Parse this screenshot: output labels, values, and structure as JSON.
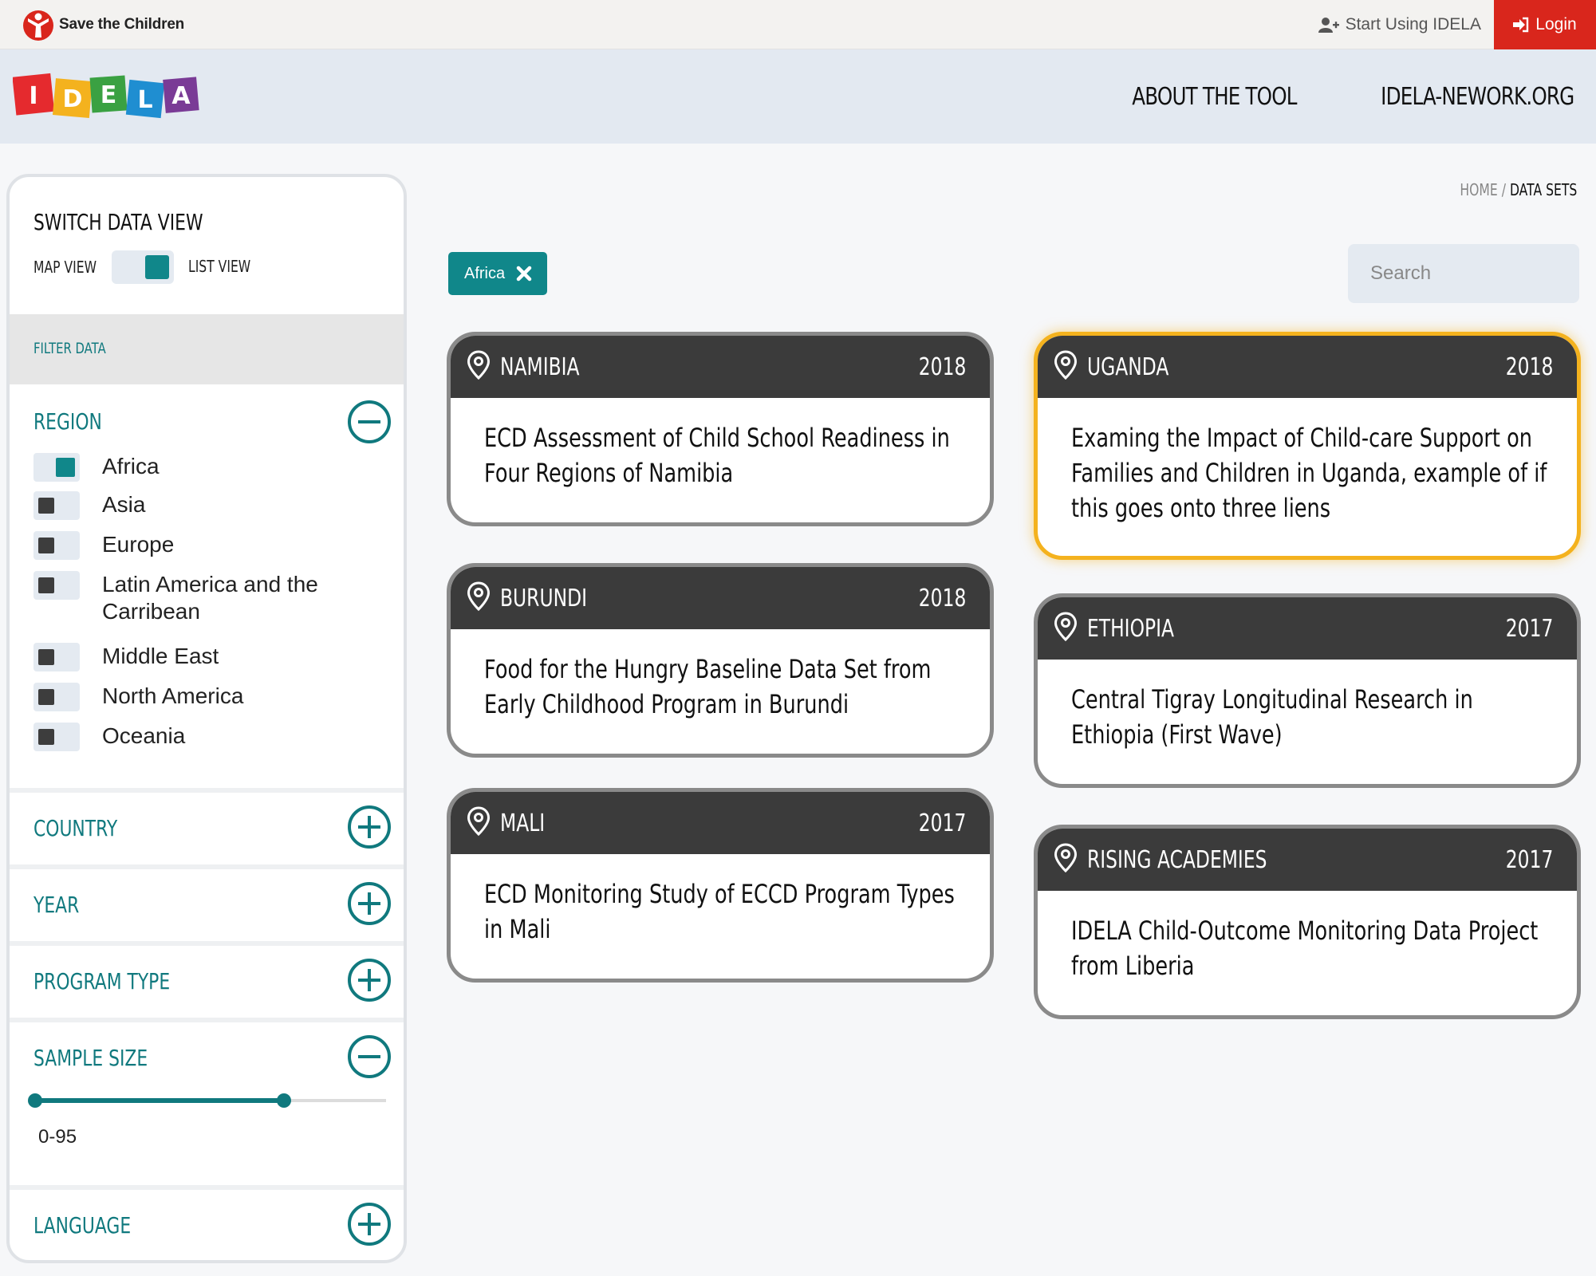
{
  "topbar": {
    "org_name": "Save the Children",
    "start_label": "Start Using IDELA",
    "login_label": "Login"
  },
  "header": {
    "logo_letters": [
      "I",
      "D",
      "E",
      "L",
      "A"
    ],
    "nav": [
      "ABOUT THE TOOL",
      "IDELA-NEWORK.ORG"
    ]
  },
  "sidebar": {
    "switch_title": "SWITCH DATA VIEW",
    "map_view": "MAP VIEW",
    "list_view": "LIST VIEW",
    "filter_label": "FILTER DATA",
    "region": {
      "title": "REGION",
      "items": [
        {
          "label": "Africa",
          "checked": true
        },
        {
          "label": "Asia",
          "checked": false
        },
        {
          "label": "Europe",
          "checked": false
        },
        {
          "label": "Latin America and the Carribean",
          "checked": false
        },
        {
          "label": "Middle East",
          "checked": false
        },
        {
          "label": "North America",
          "checked": false
        },
        {
          "label": "Oceania",
          "checked": false
        }
      ]
    },
    "country_title": "COUNTRY",
    "year_title": "YEAR",
    "program_type_title": "PROGRAM TYPE",
    "sample_size": {
      "title": "SAMPLE SIZE",
      "range_text": "0-95",
      "low_fraction": 0.0,
      "high_fraction": 0.71
    },
    "language_title": "LANGUAGE"
  },
  "breadcrumb": {
    "home": "HOME",
    "separator": "/",
    "current": "DATA SETS"
  },
  "active_filter": "Africa",
  "search": {
    "placeholder": "Search"
  },
  "cards": [
    {
      "country": "NAMIBIA",
      "year": "2018",
      "title": "ECD Assessment of Child School Readiness in Four Regions of Namibia"
    },
    {
      "country": "BURUNDI",
      "year": "2018",
      "title": "Food for the Hungry Baseline Data Set from Early Childhood Program in Burundi"
    },
    {
      "country": "MALI",
      "year": "2017",
      "title": "ECD Monitoring Study of ECCD Program Types in Mali"
    },
    {
      "country": "UGANDA",
      "year": "2018",
      "title": "Examing the Impact of Child-care Support on Families and Children in Uganda, example of if this goes onto three liens"
    },
    {
      "country": "ETHIOPIA",
      "year": "2017",
      "title": "Central Tigray Longitudinal Research in Ethiopia (First Wave)"
    },
    {
      "country": "RISING ACADEMIES",
      "year": "2017",
      "title": "IDELA Child-Outcome Monitoring Data Project from Liberia"
    }
  ],
  "colors": {
    "teal": "#10797e",
    "accent_red": "#d9261c",
    "highlight": "#f4b21e",
    "card_header": "#3b3b3b"
  }
}
